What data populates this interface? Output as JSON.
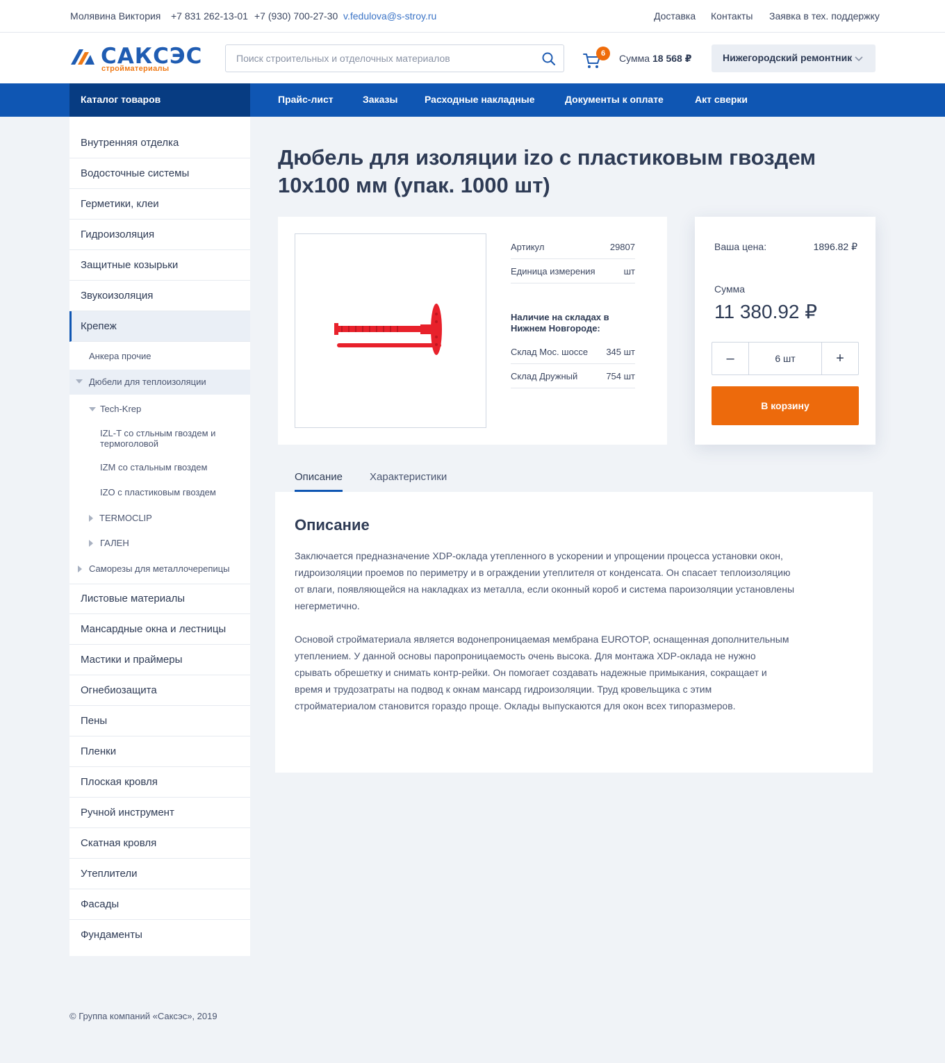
{
  "topbar": {
    "user": "Молявина Виктория",
    "phone1": "+7 831 262-13-01",
    "phone2": "+7 (930) 700-27-30",
    "email": "v.fedulova@s-stroy.ru",
    "links": [
      "Доставка",
      "Контакты",
      "Заявка в тех. поддержку"
    ]
  },
  "header": {
    "logo_name": "САКСЭС",
    "logo_sub": "стройматериалы",
    "search_placeholder": "Поиск строительных и отделочных материалов",
    "cart_count": "6",
    "cart_sum_label": "Сумма",
    "cart_sum_value": "18 568 ₽",
    "org": "Нижегородский ремонтник"
  },
  "nav": {
    "catalog": "Каталог товаров",
    "links": [
      "Прайс-лист",
      "Заказы",
      "Расходные накладные",
      "Документы к оплате",
      "Акт сверки"
    ]
  },
  "sidebar": {
    "top_items": [
      "Внутренняя отделка",
      "Водосточные системы",
      "Герметики, клеи",
      "Гидроизоляция",
      "Защитные козырьки",
      "Звукоизоляция"
    ],
    "active": "Крепеж",
    "sub": {
      "anchors": "Анкера прочие",
      "dowels": "Дюбели для теплоизоляции",
      "techkrep": "Tech-Krep",
      "izlt": "IZL-T со стльным гвоздем и термоголовой",
      "izm": "IZM со стальным гвоздем",
      "izo": "IZO с пластиковым гвоздем",
      "termoclip": "TERMOCLIP",
      "galen": "ГАЛЕН",
      "screws": "Саморезы для металлочерепицы"
    },
    "bottom_items": [
      "Листовые материалы",
      "Мансардные окна и лестницы",
      "Мастики и праймеры",
      "Огнебиозащита",
      "Пены",
      "Пленки",
      "Плоская кровля",
      "Ручной инструмент",
      "Скатная кровля",
      "Утеплители",
      "Фасады",
      "Фундаменты"
    ]
  },
  "product": {
    "title": "Дюбель для изоляции izo с пластиковым гвоздем 10х100 мм (упак. 1000 шт)",
    "article_label": "Артикул",
    "article_value": "29807",
    "unit_label": "Единица измерения",
    "unit_value": "шт",
    "stock_title": "Наличие на складах в Нижнем Новгороде:",
    "stock": [
      {
        "name": "Склад Мос. шоссе",
        "qty": "345 шт"
      },
      {
        "name": "Склад Дружный",
        "qty": "754 шт"
      }
    ],
    "image_color": "#e8212b"
  },
  "buy": {
    "your_price_label": "Ваша цена:",
    "your_price": "1896.82 ₽",
    "sum_label": "Сумма",
    "sum": "11 380.92 ₽",
    "minus": "–",
    "qty": "6 шт",
    "plus": "+",
    "add_to_cart": "В корзину"
  },
  "tabs": [
    "Описание",
    "Характеристики"
  ],
  "description": {
    "title": "Описание",
    "p1": "Заключается предназначение XDP-оклада утепленного в ускорении и упрощении процесса установки окон, гидроизоляции проемов по периметру и в ограждении утеплителя от конденсата. Он спасает теплоизоляцию от влаги, появляющейся на накладках из металла, если оконный короб и система пароизоляции установлены негерметично.",
    "p2": "Основой стройматериала является водонепроницаемая мембрана EUROTOP, оснащенная дополнительным утеплением. У данной основы паропроницаемость очень высока. Для монтажа XDP-оклада не нужно срывать обрешетку и снимать контр-рейки. Он помогает создавать надежные примыкания, сокращает и время и трудозатраты на подвод к окнам мансард гидроизоляции. Труд кровельщика с этим стройматериалом становится гораздо проще. Оклады выпускаются для окон всех типоразмеров."
  },
  "footer": "© Группа компаний «Саксэс», 2019",
  "colors": {
    "primary": "#0f56b3",
    "accent": "#ed6a0c",
    "text": "#2e3b55"
  }
}
